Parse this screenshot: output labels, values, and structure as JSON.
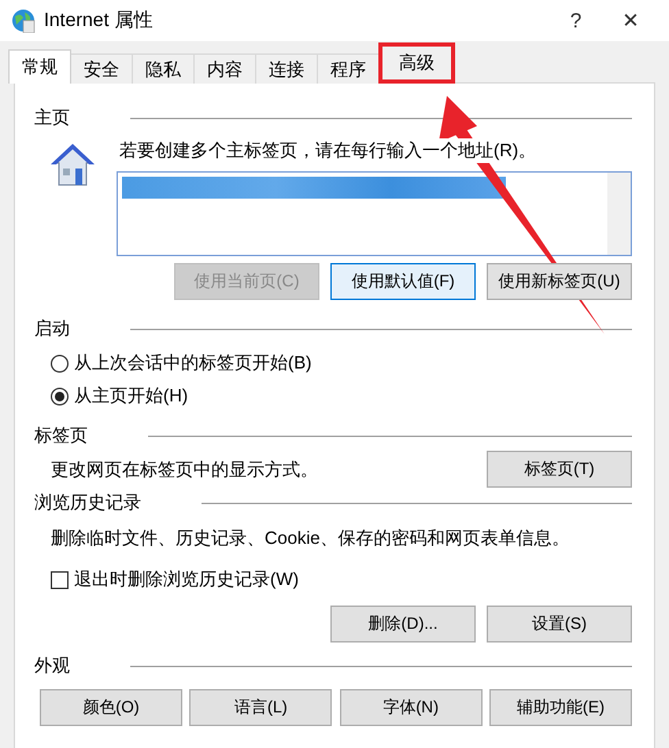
{
  "window": {
    "title": "Internet 属性",
    "help": "?",
    "close": "✕"
  },
  "tabs": [
    {
      "label": "常规",
      "selected": true,
      "highlighted": false
    },
    {
      "label": "安全",
      "selected": false,
      "highlighted": false
    },
    {
      "label": "隐私",
      "selected": false,
      "highlighted": false
    },
    {
      "label": "内容",
      "selected": false,
      "highlighted": false
    },
    {
      "label": "连接",
      "selected": false,
      "highlighted": false
    },
    {
      "label": "程序",
      "selected": false,
      "highlighted": false
    },
    {
      "label": "高级",
      "selected": false,
      "highlighted": true
    }
  ],
  "home": {
    "heading": "主页",
    "description": "若要创建多个主标签页，请在每行输入一个地址(R)。",
    "buttons": [
      {
        "label": "使用当前页(C)",
        "disabled": true,
        "focused": false
      },
      {
        "label": "使用默认值(F)",
        "disabled": false,
        "focused": true
      },
      {
        "label": "使用新标签页(U)",
        "disabled": false,
        "focused": false
      }
    ]
  },
  "startup": {
    "heading": "启动",
    "options": [
      {
        "label": "从上次会话中的标签页开始(B)",
        "selected": false
      },
      {
        "label": "从主页开始(H)",
        "selected": true
      }
    ]
  },
  "tabs_section": {
    "heading": "标签页",
    "description": "更改网页在标签页中的显示方式。",
    "button": "标签页(T)"
  },
  "history": {
    "heading": "浏览历史记录",
    "description": "删除临时文件、历史记录、Cookie、保存的密码和网页表单信息。",
    "checkbox": {
      "label": "退出时删除浏览历史记录(W)",
      "checked": false
    },
    "buttons": [
      "删除(D)...",
      "设置(S)"
    ]
  },
  "appearance": {
    "heading": "外观",
    "buttons": [
      "颜色(O)",
      "语言(L)",
      "字体(N)",
      "辅助功能(E)"
    ]
  }
}
